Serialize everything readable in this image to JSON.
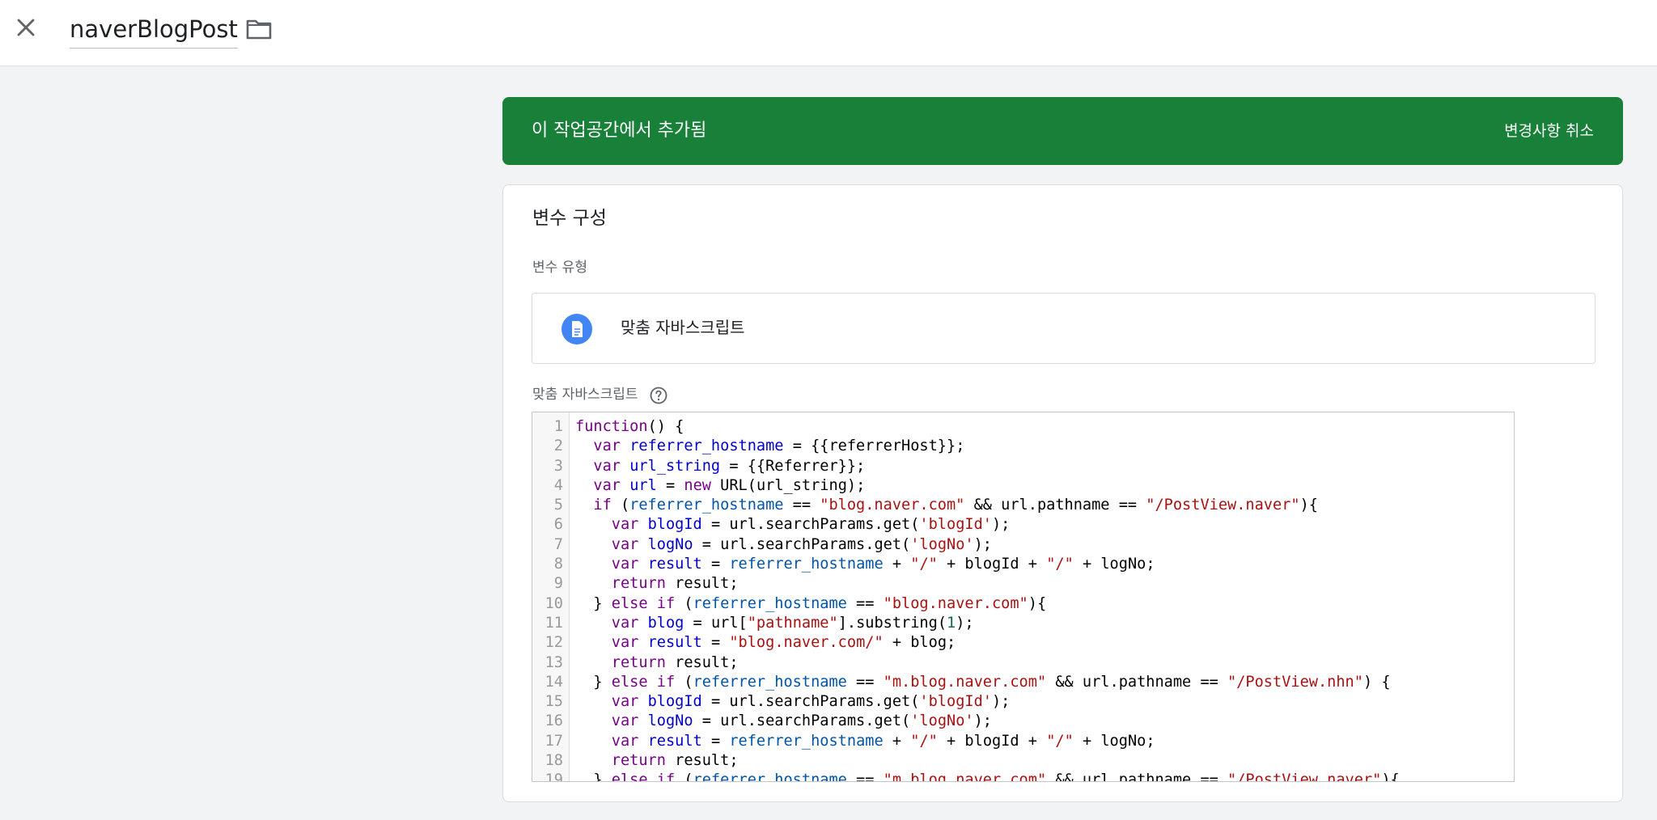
{
  "header": {
    "title": "naverBlogPost",
    "close_icon": "close-icon",
    "folder_icon": "folder-icon"
  },
  "banner": {
    "text": "이 작업공간에서 추가됨",
    "action": "변경사항 취소",
    "color": "#188038"
  },
  "config": {
    "title": "변수 구성",
    "type_label": "변수 유형",
    "type_name": "맞춤 자바스크립트",
    "type_icon": "document-icon",
    "script_label": "맞춤 자바스크립트",
    "help_icon": "help-icon"
  },
  "code": {
    "lines": [
      [
        [
          "kw",
          "function"
        ],
        [
          "",
          "() {"
        ]
      ],
      [
        [
          "",
          "  "
        ],
        [
          "kw",
          "var"
        ],
        [
          "",
          " "
        ],
        [
          "def",
          "referrer_hostname"
        ],
        [
          "",
          " = {{referrerHost}};"
        ]
      ],
      [
        [
          "",
          "  "
        ],
        [
          "kw",
          "var"
        ],
        [
          "",
          " "
        ],
        [
          "def",
          "url_string"
        ],
        [
          "",
          " = {{Referrer}};"
        ]
      ],
      [
        [
          "",
          "  "
        ],
        [
          "kw",
          "var"
        ],
        [
          "",
          " "
        ],
        [
          "def",
          "url"
        ],
        [
          "",
          " = "
        ],
        [
          "kw",
          "new"
        ],
        [
          "",
          " URL(url_string);"
        ]
      ],
      [
        [
          "",
          "  "
        ],
        [
          "kw",
          "if"
        ],
        [
          "",
          " ("
        ],
        [
          "v2",
          "referrer_hostname"
        ],
        [
          "",
          " == "
        ],
        [
          "str",
          "\"blog.naver.com\""
        ],
        [
          "",
          " && url.pathname == "
        ],
        [
          "str",
          "\"/PostView.naver\""
        ],
        [
          "",
          "){"
        ]
      ],
      [
        [
          "",
          "    "
        ],
        [
          "kw",
          "var"
        ],
        [
          "",
          " "
        ],
        [
          "def",
          "blogId"
        ],
        [
          "",
          " = url.searchParams.get("
        ],
        [
          "str",
          "'blogId'"
        ],
        [
          "",
          ");"
        ]
      ],
      [
        [
          "",
          "    "
        ],
        [
          "kw",
          "var"
        ],
        [
          "",
          " "
        ],
        [
          "def",
          "logNo"
        ],
        [
          "",
          " = url.searchParams.get("
        ],
        [
          "str",
          "'logNo'"
        ],
        [
          "",
          ");"
        ]
      ],
      [
        [
          "",
          "    "
        ],
        [
          "kw",
          "var"
        ],
        [
          "",
          " "
        ],
        [
          "def",
          "result"
        ],
        [
          "",
          " = "
        ],
        [
          "v2",
          "referrer_hostname"
        ],
        [
          "",
          " + "
        ],
        [
          "str",
          "\"/\""
        ],
        [
          "",
          " + blogId + "
        ],
        [
          "str",
          "\"/\""
        ],
        [
          "",
          " + logNo;"
        ]
      ],
      [
        [
          "",
          "    "
        ],
        [
          "kw",
          "return"
        ],
        [
          "",
          " result;"
        ]
      ],
      [
        [
          "",
          "  } "
        ],
        [
          "kw",
          "else"
        ],
        [
          "",
          " "
        ],
        [
          "kw",
          "if"
        ],
        [
          "",
          " ("
        ],
        [
          "v2",
          "referrer_hostname"
        ],
        [
          "",
          " == "
        ],
        [
          "str",
          "\"blog.naver.com\""
        ],
        [
          "",
          "){"
        ]
      ],
      [
        [
          "",
          "    "
        ],
        [
          "kw",
          "var"
        ],
        [
          "",
          " "
        ],
        [
          "def",
          "blog"
        ],
        [
          "",
          " = url["
        ],
        [
          "str",
          "\"pathname\""
        ],
        [
          "",
          "].substring("
        ],
        [
          "num",
          "1"
        ],
        [
          "",
          ");"
        ]
      ],
      [
        [
          "",
          "    "
        ],
        [
          "kw",
          "var"
        ],
        [
          "",
          " "
        ],
        [
          "def",
          "result"
        ],
        [
          "",
          " = "
        ],
        [
          "str",
          "\"blog.naver.com/\""
        ],
        [
          "",
          " + blog;"
        ]
      ],
      [
        [
          "",
          "    "
        ],
        [
          "kw",
          "return"
        ],
        [
          "",
          " result;"
        ]
      ],
      [
        [
          "",
          "  } "
        ],
        [
          "kw",
          "else"
        ],
        [
          "",
          " "
        ],
        [
          "kw",
          "if"
        ],
        [
          "",
          " ("
        ],
        [
          "v2",
          "referrer_hostname"
        ],
        [
          "",
          " == "
        ],
        [
          "str",
          "\"m.blog.naver.com\""
        ],
        [
          "",
          " && url.pathname == "
        ],
        [
          "str",
          "\"/PostView.nhn\""
        ],
        [
          "",
          ") {"
        ]
      ],
      [
        [
          "",
          "    "
        ],
        [
          "kw",
          "var"
        ],
        [
          "",
          " "
        ],
        [
          "def",
          "blogId"
        ],
        [
          "",
          " = url.searchParams.get("
        ],
        [
          "str",
          "'blogId'"
        ],
        [
          "",
          ");"
        ]
      ],
      [
        [
          "",
          "    "
        ],
        [
          "kw",
          "var"
        ],
        [
          "",
          " "
        ],
        [
          "def",
          "logNo"
        ],
        [
          "",
          " = url.searchParams.get("
        ],
        [
          "str",
          "'logNo'"
        ],
        [
          "",
          ");"
        ]
      ],
      [
        [
          "",
          "    "
        ],
        [
          "kw",
          "var"
        ],
        [
          "",
          " "
        ],
        [
          "def",
          "result"
        ],
        [
          "",
          " = "
        ],
        [
          "v2",
          "referrer_hostname"
        ],
        [
          "",
          " + "
        ],
        [
          "str",
          "\"/\""
        ],
        [
          "",
          " + blogId + "
        ],
        [
          "str",
          "\"/\""
        ],
        [
          "",
          " + logNo;"
        ]
      ],
      [
        [
          "",
          "    "
        ],
        [
          "kw",
          "return"
        ],
        [
          "",
          " result;"
        ]
      ],
      [
        [
          "",
          "  } "
        ],
        [
          "kw",
          "else"
        ],
        [
          "",
          " "
        ],
        [
          "kw",
          "if"
        ],
        [
          "",
          " ("
        ],
        [
          "v2",
          "referrer_hostname"
        ],
        [
          "",
          " == "
        ],
        [
          "str",
          "\"m.blog.naver.com\""
        ],
        [
          "",
          " && url.pathname == "
        ],
        [
          "str",
          "\"/PostView.naver\""
        ],
        [
          "",
          "){"
        ]
      ]
    ]
  }
}
